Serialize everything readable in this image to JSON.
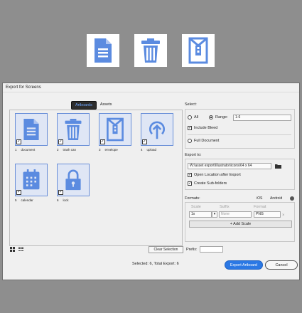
{
  "dialog": {
    "title": "Export for Screens",
    "tabs": [
      {
        "label": "Artboards",
        "active": true
      },
      {
        "label": "Assets",
        "active": false
      }
    ]
  },
  "artboards": [
    {
      "num": "1",
      "name": "document",
      "icon": "document-icon",
      "checked": true
    },
    {
      "num": "2",
      "name": "trash can",
      "icon": "trash-can-icon",
      "checked": true
    },
    {
      "num": "3",
      "name": "envelope",
      "icon": "envelope-icon",
      "checked": true
    },
    {
      "num": "4",
      "name": "upload",
      "icon": "upload-icon",
      "checked": true
    },
    {
      "num": "5",
      "name": "calendar",
      "icon": "calendar-icon",
      "checked": true
    },
    {
      "num": "6",
      "name": "lock",
      "icon": "lock-icon",
      "checked": true
    }
  ],
  "clear_selection_label": "Clear Selection",
  "prefix_label": "Prefix:",
  "prefix_value": "",
  "select": {
    "heading": "Select:",
    "all_label": "All",
    "range_label": "Range:",
    "range_value": "1-6",
    "include_bleed_label": "Include Bleed",
    "full_document_label": "Full Document"
  },
  "export_to": {
    "heading": "Export to:",
    "path": "W:\\asset export\\Illustrator\\icons\\64 x 64",
    "open_location_label": "Open Location after Export",
    "create_subfolders_label": "Create Sub-folders"
  },
  "formats": {
    "heading": "Formats:",
    "platforms": [
      "iOS",
      "Android"
    ],
    "columns": [
      "Scale",
      "Suffix",
      "Format"
    ],
    "row": {
      "scale": "1x",
      "suffix_placeholder": "None",
      "format": "PNG"
    },
    "add_scale_label": "+ Add Scale"
  },
  "status": "Selected: 6, Total Export: 6",
  "export_button": "Export Artboard",
  "cancel_button": "Cancel",
  "colors": {
    "accent": "#2b78e4",
    "icon_blue": "#5b8be0",
    "thumb_bg": "#dfe6f5"
  }
}
